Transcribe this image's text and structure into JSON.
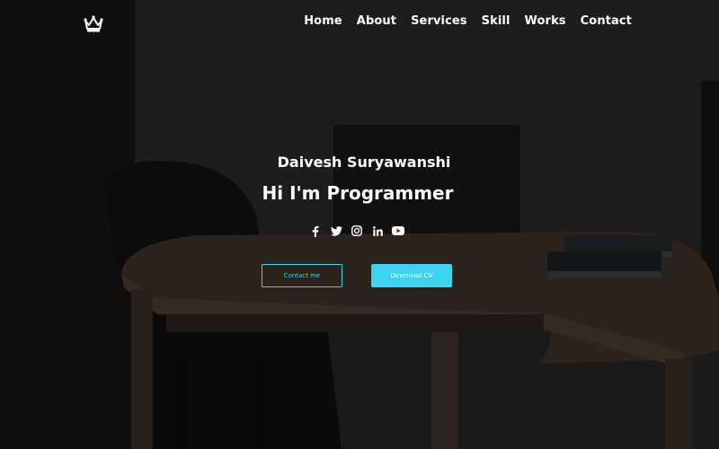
{
  "colors": {
    "accent": "#3dd3f2",
    "text": "#ffffff"
  },
  "nav": {
    "logo_icon": "crown-icon",
    "items": [
      {
        "label": "Home"
      },
      {
        "label": "About"
      },
      {
        "label": "Services"
      },
      {
        "label": "Skill"
      },
      {
        "label": "Works"
      },
      {
        "label": "Contact"
      }
    ]
  },
  "hero": {
    "name": "Daivesh Suryawanshi",
    "role": "Hi I'm Programmer",
    "social_icons": [
      "facebook-icon",
      "twitter-icon",
      "instagram-icon",
      "linkedin-icon",
      "youtube-icon"
    ],
    "buttons": {
      "contact_label": "Contact me",
      "download_label": "Download CV"
    }
  }
}
